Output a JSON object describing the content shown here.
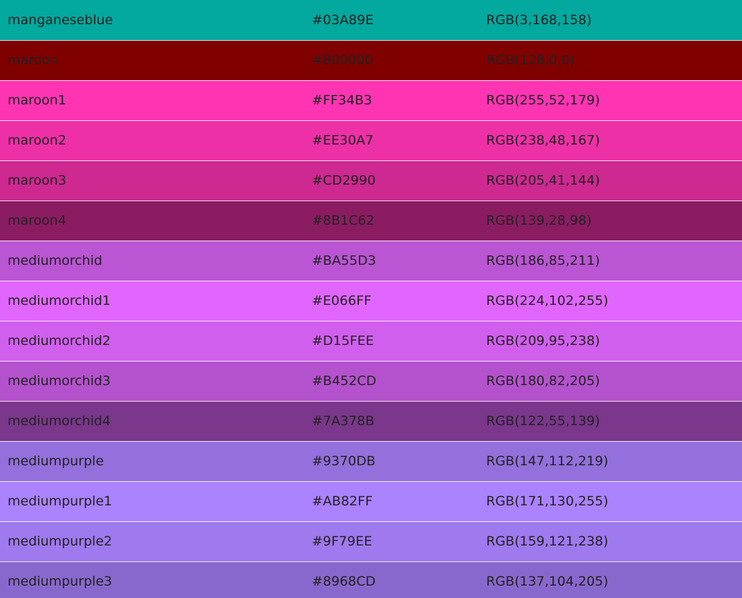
{
  "colors": [
    {
      "name": "manganeseblue",
      "hex": "#03A89E",
      "rgb": "RGB(3,168,158)"
    },
    {
      "name": "maroon",
      "hex": "#800000",
      "rgb": "RGB(128,0,0)"
    },
    {
      "name": "maroon1",
      "hex": "#FF34B3",
      "rgb": "RGB(255,52,179)"
    },
    {
      "name": "maroon2",
      "hex": "#EE30A7",
      "rgb": "RGB(238,48,167)"
    },
    {
      "name": "maroon3",
      "hex": "#CD2990",
      "rgb": "RGB(205,41,144)"
    },
    {
      "name": "maroon4",
      "hex": "#8B1C62",
      "rgb": "RGB(139,28,98)"
    },
    {
      "name": "mediumorchid",
      "hex": "#BA55D3",
      "rgb": "RGB(186,85,211)"
    },
    {
      "name": "mediumorchid1",
      "hex": "#E066FF",
      "rgb": "RGB(224,102,255)"
    },
    {
      "name": "mediumorchid2",
      "hex": "#D15FEE",
      "rgb": "RGB(209,95,238)"
    },
    {
      "name": "mediumorchid3",
      "hex": "#B452CD",
      "rgb": "RGB(180,82,205)"
    },
    {
      "name": "mediumorchid4",
      "hex": "#7A378B",
      "rgb": "RGB(122,55,139)"
    },
    {
      "name": "mediumpurple",
      "hex": "#9370DB",
      "rgb": "RGB(147,112,219)"
    },
    {
      "name": "mediumpurple1",
      "hex": "#AB82FF",
      "rgb": "RGB(171,130,255)"
    },
    {
      "name": "mediumpurple2",
      "hex": "#9F79EE",
      "rgb": "RGB(159,121,238)"
    },
    {
      "name": "mediumpurple3",
      "hex": "#8968CD",
      "rgb": "RGB(137,104,205)"
    }
  ]
}
